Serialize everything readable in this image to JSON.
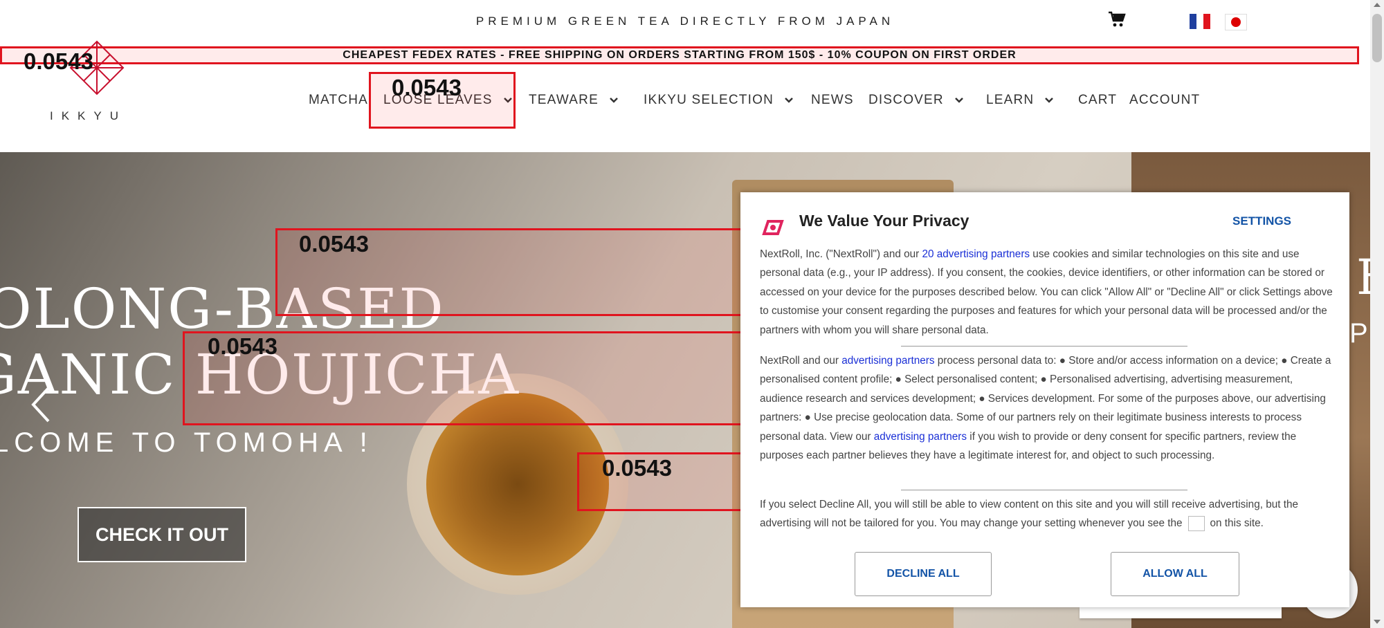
{
  "topbar": {
    "tagline": "PREMIUM GREEN TEA DIRECTLY FROM JAPAN"
  },
  "shipping_banner": "CHEAPEST FEDEX RATES - FREE SHIPPING ON ORDERS STARTING FROM 150$ - 10% COUPON ON FIRST ORDER",
  "logo": {
    "text": "IKKYU"
  },
  "nav": {
    "items": [
      {
        "label": "MATCHA"
      },
      {
        "label": "LOOSE LEAVES"
      },
      {
        "label": "TEAWARE"
      },
      {
        "label": "IKKYU SELECTION"
      },
      {
        "label": "NEWS"
      },
      {
        "label": "DISCOVER"
      },
      {
        "label": "LEARN"
      },
      {
        "label": "CART"
      },
      {
        "label": "ACCOUNT"
      }
    ]
  },
  "overlay_labels": [
    "0.0543",
    "0.0543",
    "0.0543",
    "0.0543",
    "0.0543"
  ],
  "hero": {
    "line1": "OLONG-BASED",
    "line2": "GANIC HOUJICHA",
    "line3": "LCOME TO TOMOHA !",
    "cta": "CHECK IT OUT",
    "right_line1": "E",
    "right_line2": "PE"
  },
  "privacy": {
    "title": "We Value Your Privacy",
    "settings": "SETTINGS",
    "p1_a": "NextRoll, Inc. (\"NextRoll\") and our ",
    "p1_link": "20 advertising partners",
    "p1_b": " use cookies and similar technologies on this site and use personal data (e.g., your IP address). If you consent, the cookies, device identifiers, or other information can be stored or accessed on your device for the purposes described below. You can click \"Allow All\" or \"Decline All\" or click Settings above to customise your consent regarding the purposes and features for which your personal data will be processed and/or the partners with whom you will share personal data.",
    "p2_a": "NextRoll and our ",
    "p2_link1": "advertising partners",
    "p2_b": " process personal data to: ● Store and/or access information on a device; ● Create a personalised content profile; ● Select personalised content; ● Personalised advertising, advertising measurement, audience research and services development; ● Services development. For some of the purposes above, our advertising partners: ● Use precise geolocation data. Some of our partners rely on their legitimate business interests to process personal data. View our ",
    "p2_link2": "advertising partners",
    "p2_c": " if you wish to provide or deny consent for specific partners, review the purposes each partner believes they have a legitimate interest for, and object to such processing.",
    "p3_a": "If you select Decline All, you will still be able to view content on this site and you will still receive advertising, but the advertising will not be tailored for you. You may change your setting whenever you see the",
    "p3_b": "on this site.",
    "decline": "DECLINE ALL",
    "allow": "ALLOW ALL"
  },
  "colors": {
    "accent": "#e0141e",
    "link": "#1253a6",
    "privacy_icon": "#e0245e"
  }
}
